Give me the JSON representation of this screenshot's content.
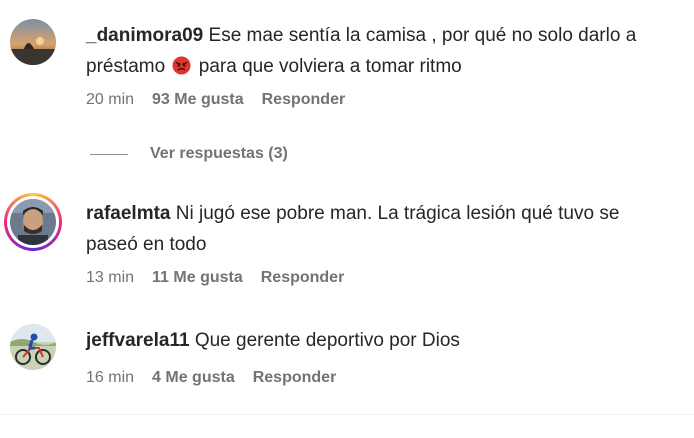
{
  "comments": [
    {
      "username": "_danimora09",
      "text_before_emoji": "Ese mae sentía la camisa , por qué no solo darlo a préstamo",
      "emoji": "angry-face-icon",
      "text_after_emoji": "para que volviera a tomar ritmo",
      "time": "20 min",
      "likes": "93 Me gusta",
      "reply": "Responder",
      "view_replies": "Ver respuestas (3)"
    },
    {
      "username": "rafaelmta",
      "text": "Ni jugó ese pobre man. La trágica lesión qué tuvo se paseó en todo",
      "time": "13 min",
      "likes": "11 Me gusta",
      "reply": "Responder"
    },
    {
      "username": "jeffvarela11",
      "text": "Que gerente deportivo por Dios",
      "time": "16 min",
      "likes": "4 Me gusta",
      "reply": "Responder"
    }
  ],
  "colors": {
    "text": "#262626",
    "meta": "#737373",
    "story_ring": [
      "#f9ce34",
      "#ee2a7b",
      "#6228d7"
    ],
    "emoji_red": "#e0352b"
  }
}
